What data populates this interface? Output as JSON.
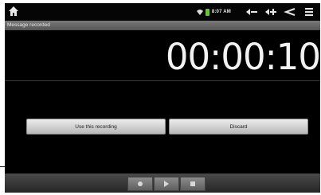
{
  "status_bar": {
    "time": "8:07 AM",
    "icons": [
      "home-icon",
      "wifi-icon",
      "battery-icon",
      "volume-down-icon",
      "volume-up-icon",
      "back-icon",
      "menu-icon"
    ]
  },
  "title_bar": {
    "title": "Message recorded"
  },
  "recorder": {
    "elapsed": "00:00:10"
  },
  "actions": {
    "use_label": "Use this recording",
    "discard_label": "Discard"
  },
  "controls": {
    "icons": [
      "record-icon",
      "play-icon",
      "stop-icon"
    ]
  }
}
